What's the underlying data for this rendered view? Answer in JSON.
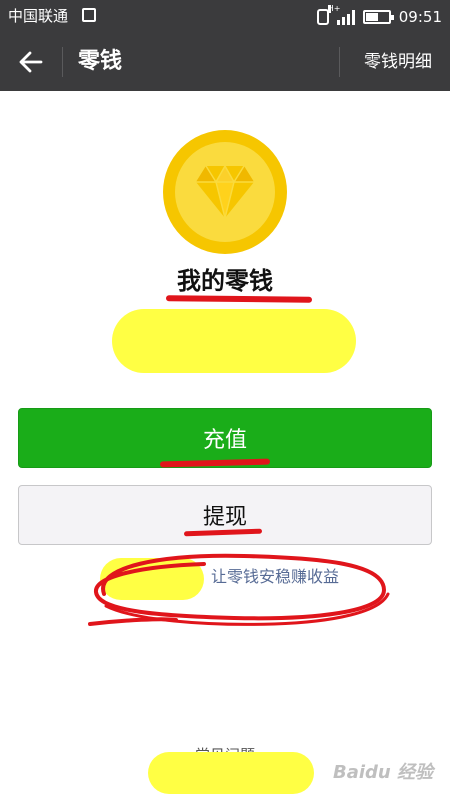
{
  "status_bar": {
    "carrier": "中国联通",
    "network": "H+",
    "time": "09:51"
  },
  "nav": {
    "title": "零钱",
    "detail_link": "零钱明细"
  },
  "wallet": {
    "title": "我的零钱",
    "coin_icon": "diamond-icon"
  },
  "buttons": {
    "recharge_label": "充值",
    "withdraw_label": "提现"
  },
  "earn_link": "让零钱安稳赚收益",
  "faq_link": "常见问题",
  "watermark": "Baidu 经验",
  "colors": {
    "nav_background": "#3b3b3d",
    "primary_green": "#1aad19",
    "coin_gold": "#f6c600",
    "link_blue": "#576b95",
    "annotation_red": "#e0151b",
    "annotation_yellow": "#ffff44"
  }
}
